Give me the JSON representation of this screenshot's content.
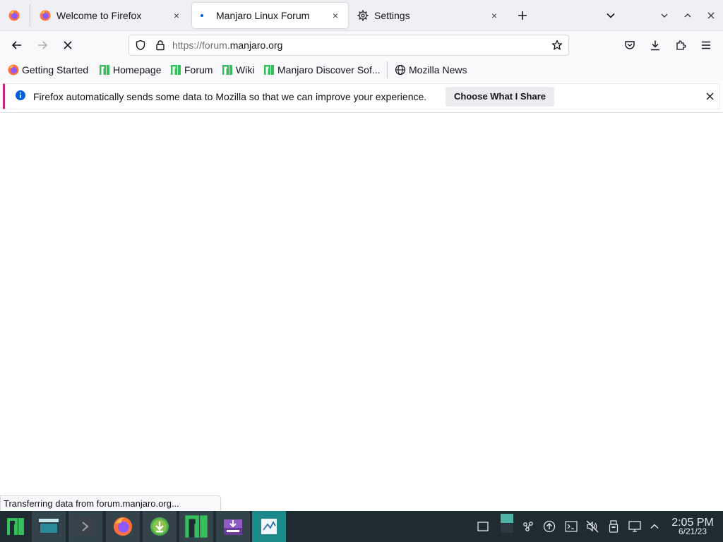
{
  "tabs": [
    {
      "label": "Welcome to Firefox",
      "icon": "firefox-icon",
      "close": "×"
    },
    {
      "label": "Manjaro Linux Forum",
      "icon": "loading-dot-icon",
      "close": "×",
      "active": true
    },
    {
      "label": "Settings",
      "icon": "gear-icon",
      "close": "×"
    }
  ],
  "navbar": {
    "url_scheme_host": "https://forum.",
    "url_domain": "manjaro.org"
  },
  "bookmarks": [
    {
      "label": "Getting Started",
      "icon": "firefox-icon"
    },
    {
      "label": "Homepage",
      "icon": "manjaro-icon"
    },
    {
      "label": "Forum",
      "icon": "manjaro-icon"
    },
    {
      "label": "Wiki",
      "icon": "manjaro-icon"
    },
    {
      "label": "Manjaro Discover Sof...",
      "icon": "manjaro-icon"
    },
    {
      "label": "Mozilla News",
      "icon": "globe-icon"
    }
  ],
  "notification": {
    "text": "Firefox automatically sends some data to Mozilla so that we can improve your experience.",
    "button": "Choose What I Share"
  },
  "status": {
    "text": "Transferring data from forum.manjaro.org..."
  },
  "clock": {
    "time": "2:05 PM",
    "date": "6/21/23"
  },
  "colors": {
    "accent": "#0060df",
    "notification_border": "#c0257a",
    "manjaro_green": "#35bf5c",
    "taskbar": "#1e2b31"
  }
}
